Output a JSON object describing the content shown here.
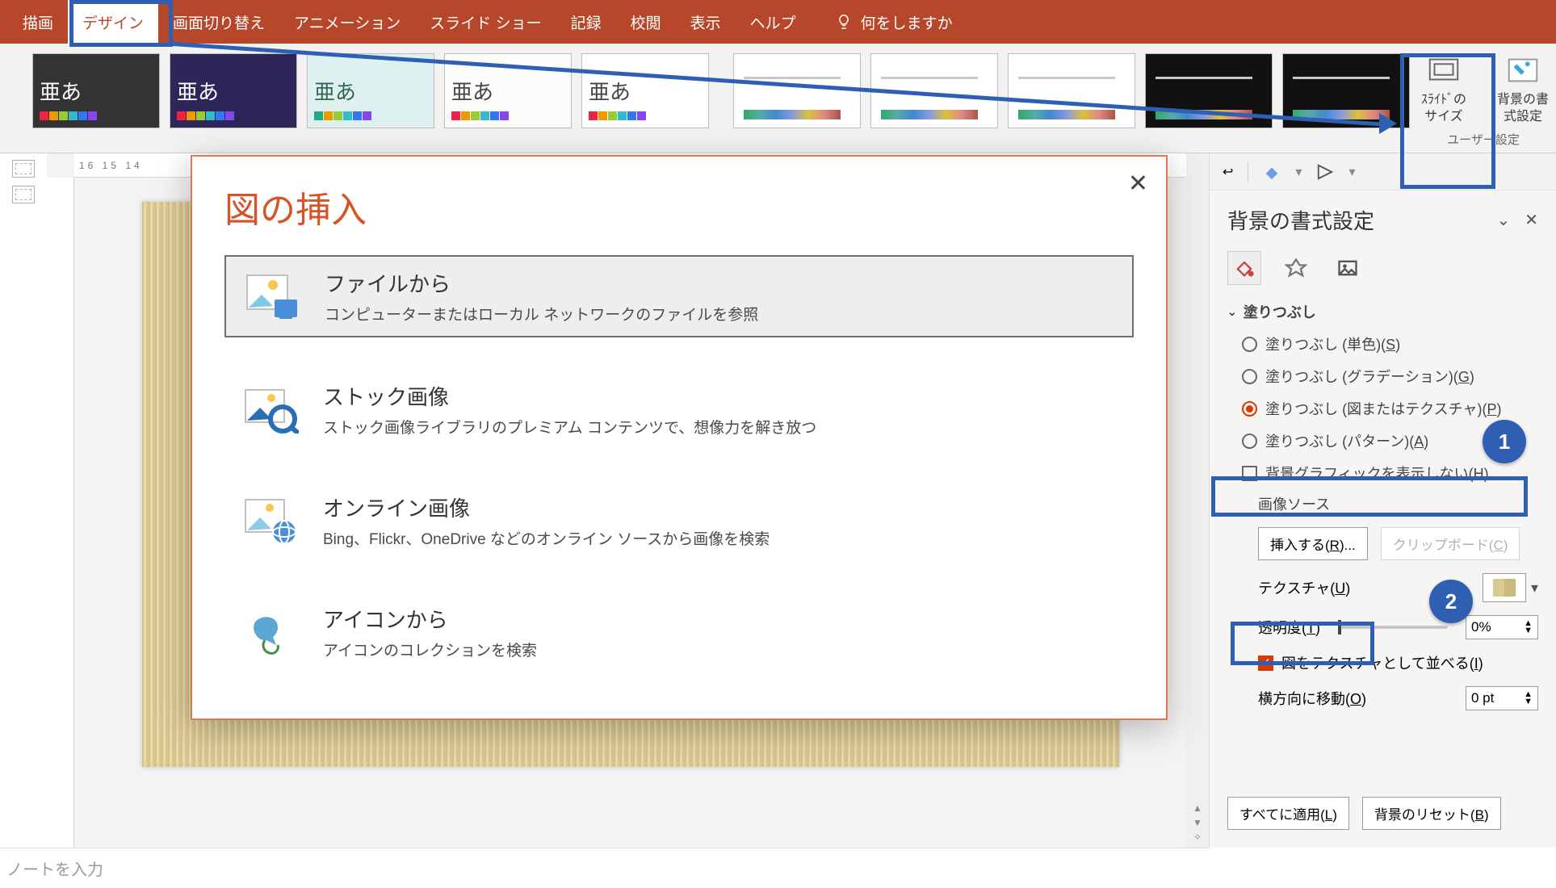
{
  "ribbon": {
    "tabs": [
      "描画",
      "デザイン",
      "画面切り替え",
      "アニメーション",
      "スライド ショー",
      "記録",
      "校閲",
      "表示",
      "ヘルプ"
    ],
    "active_tab": "デザイン",
    "tell_me": "何をしますか",
    "theme_sample": "亜あ",
    "customize": {
      "slide_size": "ｽﾗｲﾄﾞの\nサイズ",
      "format_bg": "背景の書\n式設定",
      "group_label": "ユーザー設定"
    }
  },
  "ruler_text": "16 15 14",
  "side_pane": {
    "title": "背景の書式設定",
    "section": "塗りつぶし",
    "fill_solid_pre": "塗りつぶし (単色)(",
    "fill_solid_key": "S",
    "fill_solid_post": ")",
    "fill_grad_pre": "塗りつぶし (グラデーション)(",
    "fill_grad_key": "G",
    "fill_grad_post": ")",
    "fill_pic_pre": "塗りつぶし (図またはテクスチャ)(",
    "fill_pic_key": "P",
    "fill_pic_post": ")",
    "fill_pat_pre": "塗りつぶし (パターン)(",
    "fill_pat_key": "A",
    "fill_pat_post": ")",
    "hide_bg_pre": "背景グラフィックを表示しない(",
    "hide_bg_key": "H",
    "hide_bg_post": ")",
    "image_source": "画像ソース",
    "insert_pre": "挿入する(",
    "insert_key": "R",
    "insert_post": ")...",
    "clipboard_pre": "クリップボード(",
    "clipboard_key": "C",
    "clipboard_post": ")",
    "texture_pre": "テクスチャ(",
    "texture_key": "U",
    "texture_post": ")",
    "transparency_pre": "透明度(",
    "transparency_key": "T",
    "transparency_post": ")",
    "transparency_val": "0%",
    "tile_pre": "図をテクスチャとして並べる(",
    "tile_key": "I",
    "tile_post": ")",
    "offset_x_pre": "横方向に移動(",
    "offset_x_key": "O",
    "offset_x_post": ")",
    "offset_x_val": "0 pt",
    "apply_all_pre": "すべてに適用(",
    "apply_all_key": "L",
    "apply_all_post": ")",
    "reset_pre": "背景のリセット(",
    "reset_key": "B",
    "reset_post": ")"
  },
  "dialog": {
    "title": "図の挿入",
    "from_file": {
      "title": "ファイルから",
      "desc": "コンピューターまたはローカル ネットワークのファイルを参照"
    },
    "stock": {
      "title": "ストック画像",
      "desc": "ストック画像ライブラリのプレミアム コンテンツで、想像力を解き放つ"
    },
    "online": {
      "title": "オンライン画像",
      "desc": "Bing、Flickr、OneDrive などのオンライン ソースから画像を検索"
    },
    "icons": {
      "title": "アイコンから",
      "desc": "アイコンのコレクションを検索"
    }
  },
  "notes_placeholder": "ノートを入力",
  "badges": {
    "one": "1",
    "two": "2"
  }
}
